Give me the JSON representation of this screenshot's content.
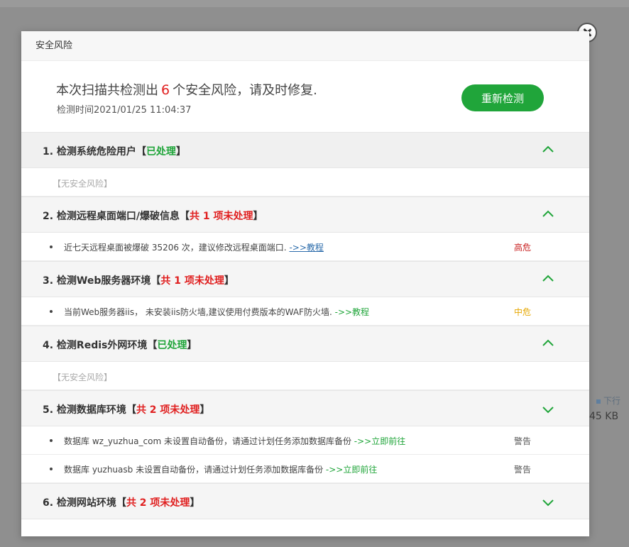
{
  "background": {
    "speed_label": "下行",
    "speed_value": "45 KB"
  },
  "dialog": {
    "title": "安全风险",
    "summary_prefix": "本次扫描共检测出",
    "risk_count": "6",
    "summary_suffix": "个安全风险，请及时修复.",
    "scan_time": "检测时间2021/01/25 11:04:37",
    "rescan_label": "重新检测"
  },
  "sections": [
    {
      "title": "1. 检测系统危险用户",
      "status": "已处理",
      "no_risk_text": "【无安全风险】"
    },
    {
      "title": "2. 检测远程桌面端口/爆破信息",
      "status": "共 1 项未处理",
      "items": [
        {
          "text": "近七天远程桌面被爆破 35206 次，建议修改远程桌面端口.",
          "link": "->>教程",
          "level": "高危"
        }
      ]
    },
    {
      "title": "3. 检测Web服务器环境",
      "status": "共 1 项未处理",
      "items": [
        {
          "text": "当前Web服务器iis， 未安装iis防火墙,建议使用付费版本的WAF防火墙.",
          "link": "->>教程",
          "level": "中危"
        }
      ]
    },
    {
      "title": "4. 检测Redis外网环境",
      "status": "已处理",
      "no_risk_text": "【无安全风险】"
    },
    {
      "title": "5. 检测数据库环境",
      "status": "共 2 项未处理",
      "items": [
        {
          "text": "数据库 wz_yuzhua_com 未设置自动备份，请通过计划任务添加数据库备份",
          "link": "->>立即前往",
          "level": "警告"
        },
        {
          "text": "数据库 yuzhuasb 未设置自动备份，请通过计划任务添加数据库备份",
          "link": "->>立即前往",
          "level": "警告"
        }
      ]
    },
    {
      "title": "6. 检测网站环境",
      "status": "共 2 项未处理"
    }
  ],
  "icons": {
    "close": "close-icon",
    "expanded": "chevron-up-icon",
    "collapsed": "chevron-down-icon"
  },
  "colors": {
    "accent_green": "#20a53a",
    "danger_red": "#e02020",
    "warning_yellow": "#e6a700"
  }
}
